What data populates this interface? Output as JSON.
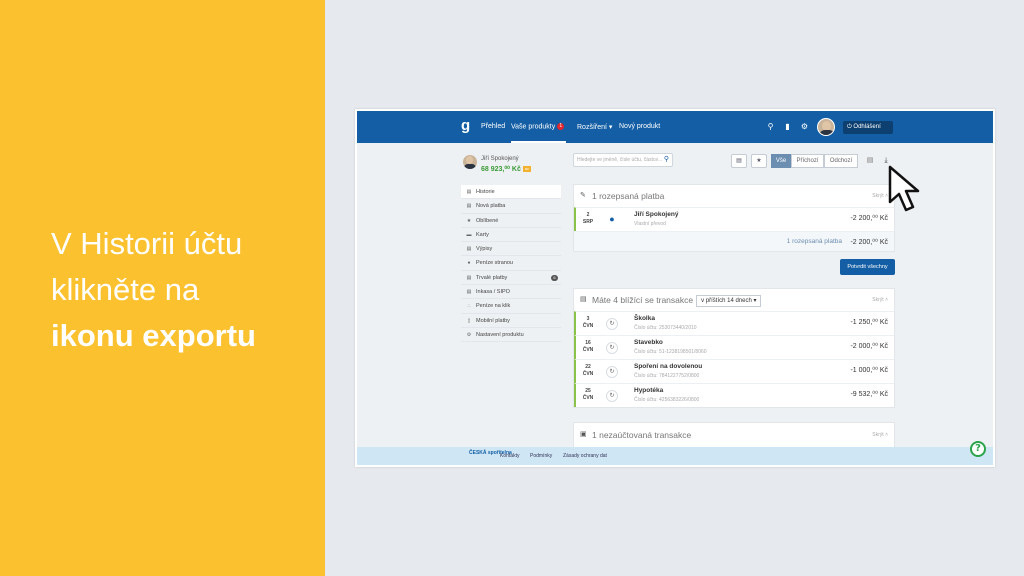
{
  "slide": {
    "line1": "V Historii účtu",
    "line2": "klikněte na",
    "line3": "ikonu exportu"
  },
  "colors": {
    "accent_yellow": "#fcc12f",
    "navbar_blue": "#135ea4",
    "positive_green": "#3a9a35"
  },
  "navbar": {
    "logo": "g",
    "items": [
      {
        "label": "Přehled"
      },
      {
        "label": "Vaše produkty",
        "badge": "1"
      },
      {
        "label": "Rozšíření ▾"
      },
      {
        "label": "Nový produkt"
      }
    ],
    "icons": [
      "search-icon",
      "chat-icon",
      "settings-icon"
    ],
    "logout_label": "Odhlášení"
  },
  "profile": {
    "name": "Jiří Spokojený",
    "balance": "68 923,⁰⁰ Kč"
  },
  "sidebar": {
    "items": [
      {
        "label": "Historie",
        "icon": "history-icon"
      },
      {
        "label": "Nová platba",
        "icon": "payment-icon"
      },
      {
        "label": "Oblíbené",
        "icon": "star-icon"
      },
      {
        "label": "Karty",
        "icon": "card-icon"
      },
      {
        "label": "Výpisy",
        "icon": "statement-icon"
      },
      {
        "label": "Peníze stranou",
        "icon": "piggy-icon"
      },
      {
        "label": "Trvalé platby",
        "icon": "standing-order-icon",
        "count": "6"
      },
      {
        "label": "Inkasa / SIPO",
        "icon": "direct-debit-icon"
      },
      {
        "label": "Peníze na klik",
        "icon": "loan-icon"
      },
      {
        "label": "Mobilní platby",
        "icon": "mobile-icon"
      },
      {
        "label": "Nastavení produktu",
        "icon": "settings-icon"
      }
    ]
  },
  "toolbar": {
    "search_placeholder": "Hledejte ve jméně, čísle účtu, částce...",
    "filters": [
      "Vše",
      "Příchozí",
      "Odchozí"
    ],
    "export_icon": "download-icon",
    "print_icon": "print-icon"
  },
  "pending_card": {
    "title": "1 rozepsaná platba",
    "hide_label": "Skrýt",
    "row": {
      "day": "2",
      "month": "SRP",
      "name": "Jiří Spokojený",
      "subtitle": "Vlastní převod",
      "amount": "-2 200,⁰⁰ Kč"
    },
    "summary_label": "1 rozepsaná platba",
    "summary_amount": "-2 200,⁰⁰ Kč",
    "confirm_label": "Potvrdit všechny"
  },
  "upcoming_card": {
    "title": "Máte 4 blížící se transakce",
    "period": "v příštích 14 dnech ▾",
    "hide_label": "Skrýt",
    "rows": [
      {
        "day": "3",
        "month": "ČVN",
        "name": "Školka",
        "subtitle": "Číslo účtu: 253073440/2010",
        "amount": "-1 250,⁰⁰ Kč"
      },
      {
        "day": "16",
        "month": "ČVN",
        "name": "Stavebko",
        "subtitle": "Číslo účtu: 51-1238198501/8060",
        "amount": "-2 000,⁰⁰ Kč"
      },
      {
        "day": "22",
        "month": "ČVN",
        "name": "Spoření na dovolenou",
        "subtitle": "Číslo účtu: 7841227752/0800",
        "amount": "-1 000,⁰⁰ Kč"
      },
      {
        "day": "25",
        "month": "ČVN",
        "name": "Hypotéka",
        "subtitle": "Číslo účtu: 4256383226/0800",
        "amount": "-9 532,⁰⁰ Kč"
      }
    ]
  },
  "unposted_card": {
    "title": "1 nezaúčtovaná transakce",
    "hide_label": "Skrýt"
  },
  "footer": {
    "logo": "ČESKÁ spořitelna",
    "links": [
      "Kontakty",
      "Podmínky",
      "Zásady ochrany dat"
    ],
    "help": "?"
  }
}
